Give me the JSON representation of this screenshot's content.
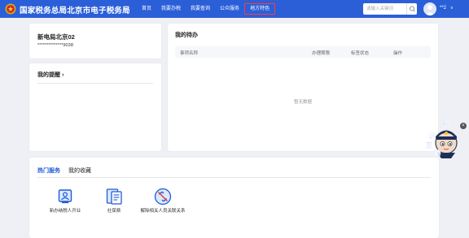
{
  "header": {
    "brand": "国家税务总局北京市电子税务局",
    "nav": [
      {
        "label": "首页"
      },
      {
        "label": "我要办税"
      },
      {
        "label": "我要查询"
      },
      {
        "label": "公众服务"
      },
      {
        "label": "地方特色",
        "active": true
      }
    ],
    "search_placeholder": "请输入关键词",
    "user_name": "**2",
    "user_caret": "∨",
    "colors": {
      "bar": "#2b5fd8",
      "active_outline": "#ff3b3b"
    }
  },
  "user_card": {
    "org_name": "新电局北京02",
    "tax_id": "**************9038"
  },
  "reminders": {
    "title": "我的提醒 ›"
  },
  "todo": {
    "title": "我的待办",
    "columns": [
      "事项名称",
      "办理期限",
      "标签状态",
      "操作"
    ],
    "empty_text": "暂无数据"
  },
  "services": {
    "tabs": [
      {
        "label": "热门服务",
        "active": true
      },
      {
        "label": "我的收藏"
      }
    ],
    "items": [
      {
        "label": "新办纳税人开业",
        "icon": "new-taxpayer-icon"
      },
      {
        "label": "社保费",
        "icon": "social-security-icon"
      },
      {
        "label": "解除相关人员关联关系",
        "icon": "unlink-relation-icon"
      }
    ],
    "accent": "#1f5bd8"
  },
  "assistant": {
    "chars": [
      "征",
      "纳",
      "互",
      "动"
    ],
    "close_label": "×"
  }
}
